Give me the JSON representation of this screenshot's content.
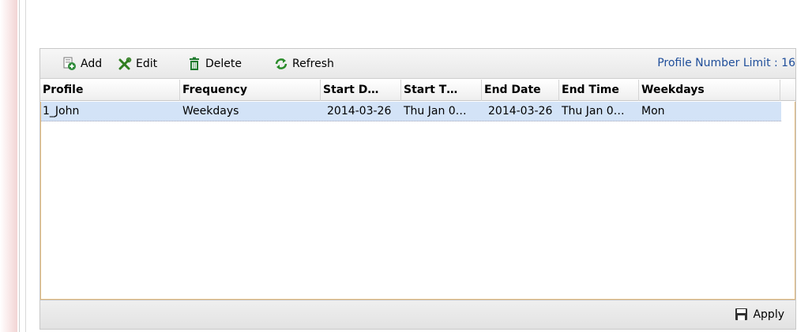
{
  "toolbar": {
    "add_label": "Add",
    "edit_label": "Edit",
    "delete_label": "Delete",
    "refresh_label": "Refresh",
    "profile_limit": "Profile Number Limit : 16"
  },
  "table": {
    "columns": [
      "Profile",
      "Frequency",
      "Start D…",
      "Start T…",
      "End Date",
      "End Time",
      "Weekdays"
    ],
    "rows": [
      [
        "1_John",
        "Weekdays",
        "2014-03-26",
        "Thu Jan 0…",
        "2014-03-26",
        "Thu Jan 0…",
        "Mon"
      ]
    ]
  },
  "footer": {
    "apply_label": "Apply"
  },
  "colors": {
    "limit_text": "#1f4e9a",
    "selected_row": "#d3e3f7",
    "add_icon": "#2e8b3a",
    "edit_icon": "#2f7d1f",
    "delete_icon": "#1f7a2e",
    "refresh_icon": "#2a8c2a"
  }
}
